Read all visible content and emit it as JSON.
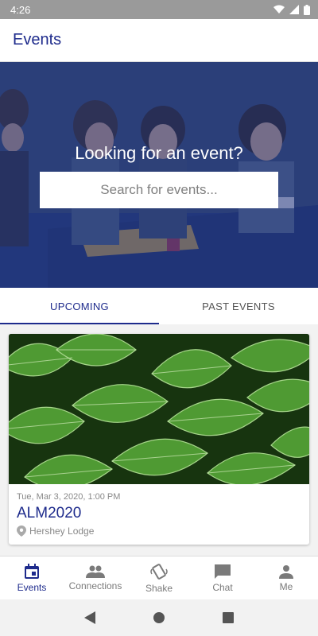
{
  "status_bar": {
    "time": "4:26"
  },
  "app_bar": {
    "title": "Events"
  },
  "hero": {
    "heading": "Looking for an event?",
    "search_placeholder": "Search for events..."
  },
  "tabs": [
    {
      "label": "UPCOMING",
      "active": true
    },
    {
      "label": "PAST EVENTS",
      "active": false
    }
  ],
  "events": [
    {
      "date": "Tue, Mar 3, 2020, 1:00 PM",
      "name": "ALM2020",
      "location": "Hershey Lodge",
      "image_icon": "leaves-photo"
    }
  ],
  "bottom_nav": [
    {
      "label": "Events",
      "icon": "calendar-icon",
      "active": true
    },
    {
      "label": "Connections",
      "icon": "people-icon",
      "active": false
    },
    {
      "label": "Shake",
      "icon": "shake-phone-icon",
      "active": false
    },
    {
      "label": "Chat",
      "icon": "chat-icon",
      "active": false
    },
    {
      "label": "Me",
      "icon": "person-icon",
      "active": false
    }
  ],
  "colors": {
    "primary": "#1e2b8c",
    "hero_overlay": "#243882",
    "status_bar": "#9a9a9a"
  }
}
